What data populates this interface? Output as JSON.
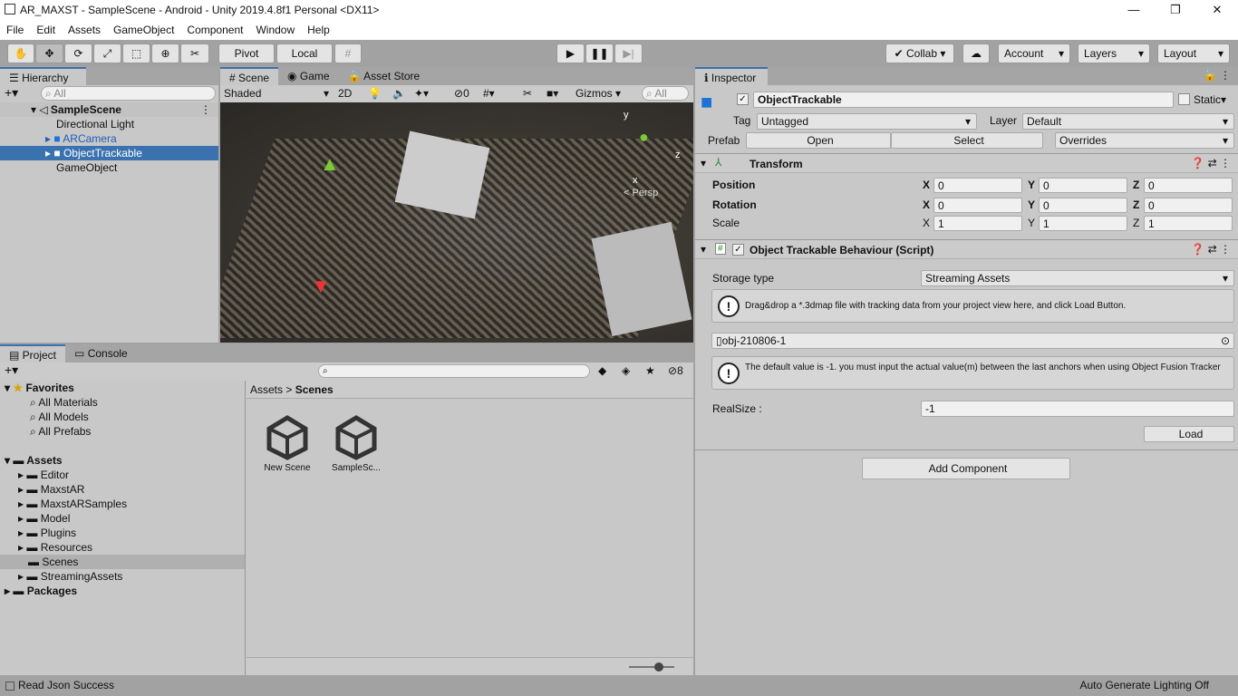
{
  "window": {
    "title": "AR_MAXST - SampleScene - Android - Unity 2019.4.8f1 Personal <DX11>",
    "min": "—",
    "max": "❐",
    "close": "✕"
  },
  "menu": [
    "File",
    "Edit",
    "Assets",
    "GameObject",
    "Component",
    "Window",
    "Help"
  ],
  "toolbar": {
    "pivot": "Pivot",
    "local": "Local",
    "collab": "Collab",
    "account": "Account",
    "layers": "Layers",
    "layout": "Layout"
  },
  "hierarchy": {
    "tab": "Hierarchy",
    "search": "All",
    "scene": "SampleScene",
    "items": [
      {
        "label": "Directional Light"
      },
      {
        "label": "ARCamera"
      },
      {
        "label": "ObjectTrackable"
      },
      {
        "label": "GameObject"
      }
    ]
  },
  "scene": {
    "tabs": [
      "Scene",
      "Game",
      "Asset Store"
    ],
    "shading": "Shaded",
    "mode2d": "2D",
    "hidden_count": "0",
    "gizmos": "Gizmos",
    "search": "All",
    "axis_y": "y",
    "axis_z": "z",
    "axis_x": "x",
    "persp": "< Persp"
  },
  "project": {
    "tabs": [
      "Project",
      "Console"
    ],
    "hidden_count": "8",
    "favorites": "Favorites",
    "fav_items": [
      "All Materials",
      "All Models",
      "All Prefabs"
    ],
    "assets": "Assets",
    "folders": [
      "Editor",
      "MaxstAR",
      "MaxstARSamples",
      "Model",
      "Plugins",
      "Resources",
      "Scenes",
      "StreamingAssets"
    ],
    "packages": "Packages",
    "breadcrumb": [
      "Assets",
      "Scenes"
    ],
    "files": [
      "New Scene",
      "SampleSc..."
    ]
  },
  "inspector": {
    "tab": "Inspector",
    "name": "ObjectTrackable",
    "static": "Static",
    "tag_label": "Tag",
    "tag": "Untagged",
    "layer_label": "Layer",
    "layer": "Default",
    "prefab_label": "Prefab",
    "open": "Open",
    "select": "Select",
    "overrides": "Overrides",
    "transform": {
      "title": "Transform",
      "rows": [
        {
          "label": "Position",
          "x": "0",
          "y": "0",
          "z": "0"
        },
        {
          "label": "Rotation",
          "x": "0",
          "y": "0",
          "z": "0"
        },
        {
          "label": "Scale",
          "x": "1",
          "y": "1",
          "z": "1"
        }
      ]
    },
    "script": {
      "title": "Object Trackable Behaviour (Script)",
      "storage_label": "Storage type",
      "storage": "Streaming Assets",
      "help1": "Drag&drop a *.3dmap file with tracking data from your project view here, and click Load Button.",
      "file": "obj-210806-1",
      "help2": "The default value is -1. you must input the actual value(m) between the last anchors when using Object Fusion Tracker",
      "realsize_label": "RealSize :",
      "realsize": "-1",
      "load": "Load"
    },
    "add_component": "Add Component"
  },
  "status": {
    "left": "Read Json Success",
    "right": "Auto Generate Lighting Off"
  }
}
